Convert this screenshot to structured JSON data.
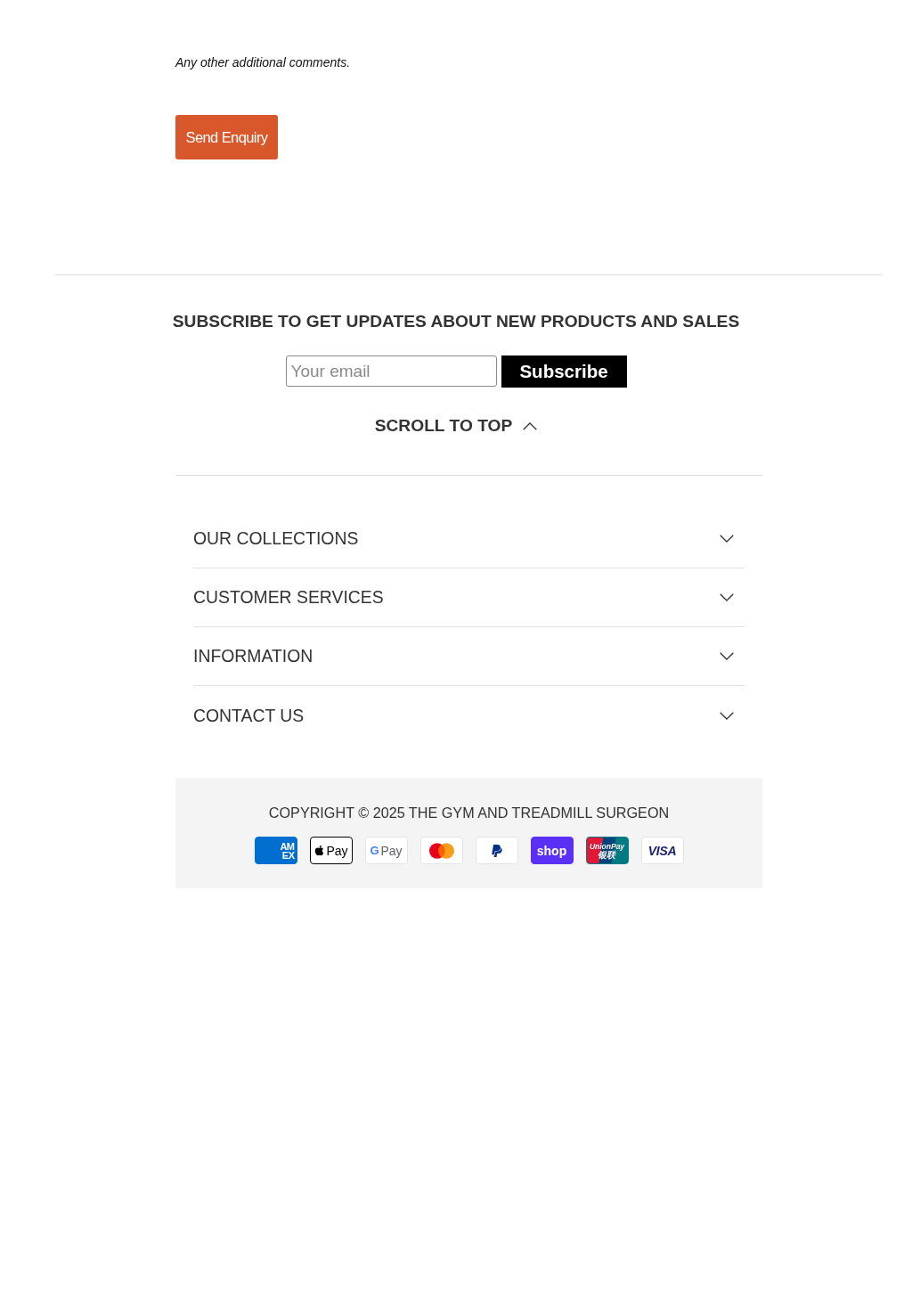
{
  "form": {
    "hint": "Any other additional comments.",
    "submit_button": "Send Enquiry"
  },
  "newsletter": {
    "heading": "SUBSCRIBE TO GET UPDATES ABOUT NEW PRODUCTS AND SALES",
    "email_field": {
      "placeholder": "Your email"
    },
    "subscribe_button": "Subscribe"
  },
  "scroll_to_top": "SCROLL TO TOP",
  "footer_menu": [
    {
      "label": "OUR COLLECTIONS",
      "expanded": false
    },
    {
      "label": "CUSTOMER SERVICES",
      "expanded": false
    },
    {
      "label": "INFORMATION",
      "expanded": false
    },
    {
      "label": "CONTACT US",
      "expanded": false
    }
  ],
  "copyright": "COPYRIGHT © 2025 THE GYM AND TREADMILL SURGEON",
  "payment_methods": [
    {
      "kind": "amex",
      "text": [
        "AM",
        "EX"
      ]
    },
    {
      "kind": "apple_pay",
      "text": [
        "Pay"
      ]
    },
    {
      "kind": "google_pay",
      "text": [
        "G",
        "Pay"
      ]
    },
    {
      "kind": "mastercard"
    },
    {
      "kind": "paypal"
    },
    {
      "kind": "shop",
      "text": [
        "shop"
      ]
    },
    {
      "kind": "unionpay",
      "text": [
        "UnionPay",
        "银联"
      ]
    },
    {
      "kind": "visa",
      "text": [
        "VISA"
      ]
    }
  ]
}
